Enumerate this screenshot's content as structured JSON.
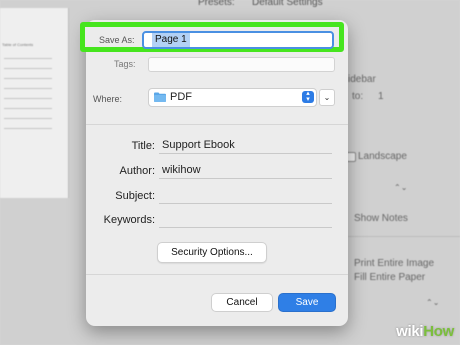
{
  "background": {
    "presets_label": "Presets:",
    "presets_value": "Default Settings",
    "toc_title": "Table of Contents",
    "sidebar_text": "idebar",
    "to_label": "to:",
    "to_value": "1",
    "landscape": "Landscape",
    "show_notes": "Show Notes",
    "print_entire_image": "Print Entire Image",
    "fill_entire_paper": "Fill Entire Paper"
  },
  "save_dialog": {
    "save_as_label": "Save As:",
    "save_as_value": "Page 1",
    "tags_label": "Tags:",
    "tags_value": "",
    "where_label": "Where:",
    "where_value": "PDF",
    "title_label": "Title:",
    "title_value": "Support Ebook",
    "author_label": "Author:",
    "author_value": "wikihow",
    "subject_label": "Subject:",
    "subject_value": "",
    "keywords_label": "Keywords:",
    "keywords_value": "",
    "security_button": "Security Options...",
    "cancel_button": "Cancel",
    "save_button": "Save"
  },
  "icons": {
    "folder": "folder-icon",
    "stepper": "up-down-stepper-icon",
    "expand": "chevron-down-icon"
  },
  "colors": {
    "highlight": "#46e51e",
    "accent": "#2f7fe6",
    "selection": "#b3d1f5"
  },
  "watermark": {
    "part1": "wiki",
    "part2": "How"
  }
}
